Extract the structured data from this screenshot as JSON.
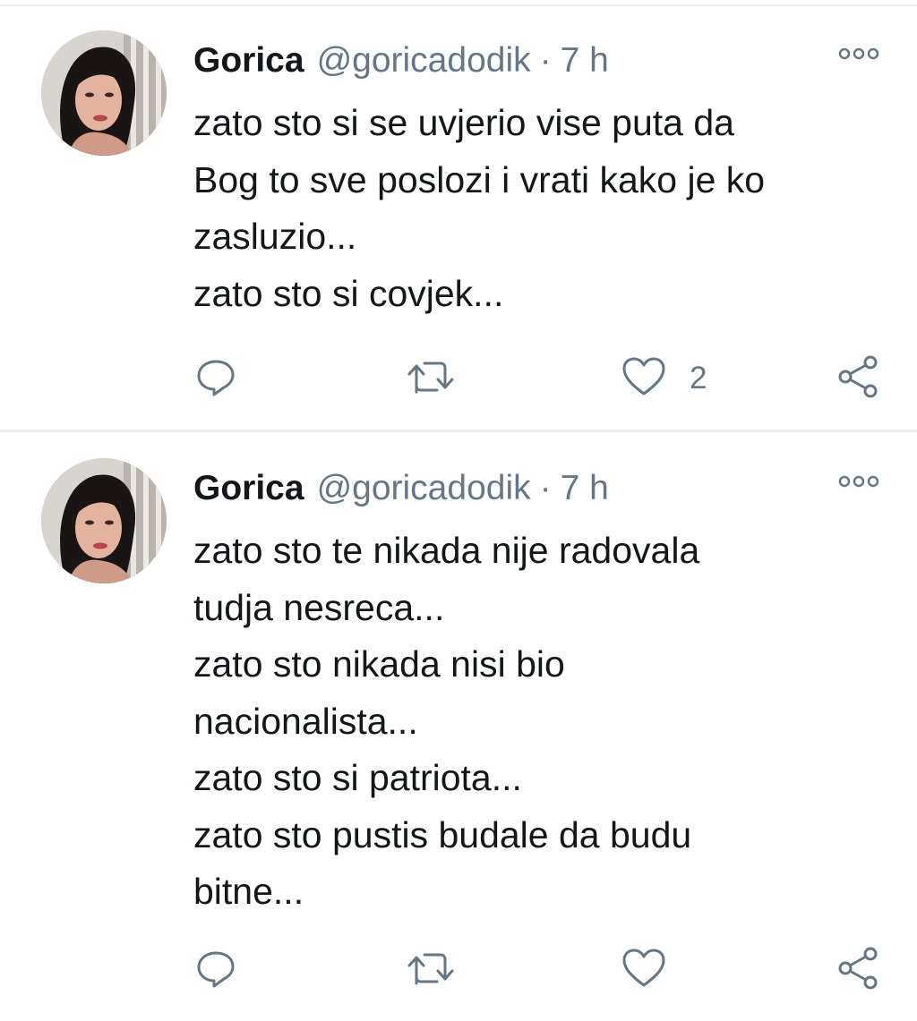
{
  "tweets": [
    {
      "author_name": "Gorica",
      "handle": "@goricadodik",
      "separator": "·",
      "time": "7 h",
      "lines": [
        "zato sto si se uvjerio vise puta da",
        "Bog to sve poslozi i vrati kako je ko",
        "zasluzio...",
        "zato sto si covjek..."
      ],
      "like_count": "2"
    },
    {
      "author_name": "Gorica",
      "handle": "@goricadodik",
      "separator": "·",
      "time": "7 h",
      "lines": [
        "zato sto te nikada nije radovala",
        "tudja nesreca...",
        "zato sto nikada nisi bio",
        "nacionalista...",
        "zato sto si patriota...",
        "zato sto pustis budale da budu",
        "bitne..."
      ],
      "like_count": ""
    }
  ],
  "icons": {
    "more": "more-options-icon",
    "reply": "reply-icon",
    "retweet": "retweet-icon",
    "like": "heart-icon",
    "share": "share-icon"
  },
  "colors": {
    "text": "#14171a",
    "secondary": "#657786",
    "divider": "#e6ecf0"
  }
}
